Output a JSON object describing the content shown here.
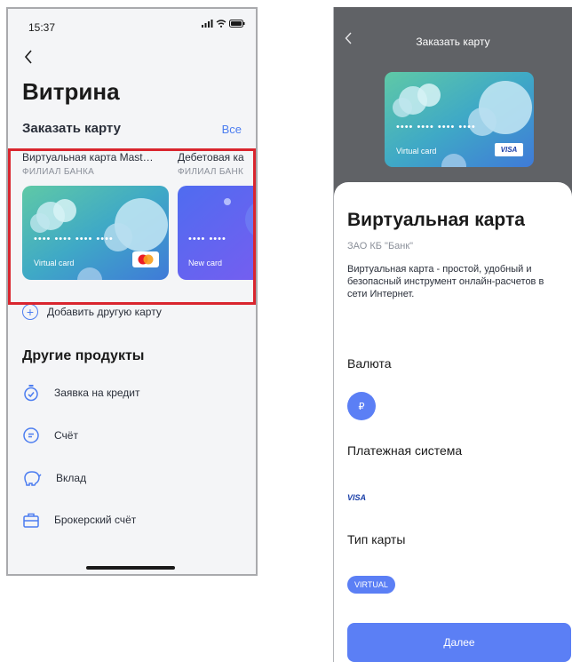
{
  "left": {
    "status": {
      "time": "15:37"
    },
    "title": "Витрина",
    "order_section": {
      "heading": "Заказать карту",
      "all_link": "Все"
    },
    "cards": [
      {
        "name": "Виртуальная карта Mast…",
        "branch": "ФИЛИАЛ БАНКА",
        "card_label": "Virtual card",
        "masked": "•••• •••• •••• ••••",
        "network": "mastercard"
      },
      {
        "name": "Дебетовая ка",
        "branch": "ФИЛИАЛ БАНК",
        "card_label": "New card",
        "masked": "•••• ••••"
      }
    ],
    "add_card_label": "Добавить другую карту",
    "other_heading": "Другие продукты",
    "products": [
      {
        "label": "Заявка на кредит",
        "icon": "stopwatch-icon"
      },
      {
        "label": "Счёт",
        "icon": "wallet-circle-icon"
      },
      {
        "label": "Вклад",
        "icon": "piggy-bank-icon"
      },
      {
        "label": "Брокерский счёт",
        "icon": "briefcase-icon"
      }
    ]
  },
  "right": {
    "header_title": "Заказать карту",
    "card_preview": {
      "label": "Virtual card",
      "masked": "•••• •••• •••• ••••",
      "network": "VISA"
    },
    "card_title": "Виртуальная карта",
    "bank": "ЗАО КБ \"Банк\"",
    "description": "Виртуальная карта - простой, удобный и безопасный инструмент онлайн-расчетов в сети Интернет.",
    "currency": {
      "heading": "Валюта",
      "symbol": "₽"
    },
    "payment_system": {
      "heading": "Платежная система",
      "value": "VISA"
    },
    "card_type": {
      "heading": "Тип карты",
      "value": "VIRTUAL"
    },
    "next_button": "Далее"
  },
  "colors": {
    "accent": "#5b7ff5",
    "highlight_border": "#d9252e",
    "header_gray": "#606266"
  }
}
